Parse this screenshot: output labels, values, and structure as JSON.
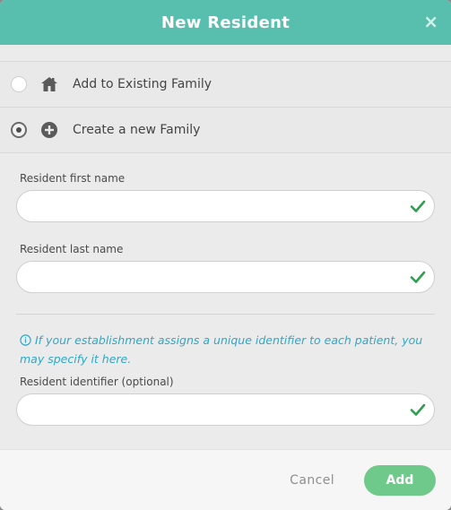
{
  "header": {
    "title": "New Resident",
    "close_symbol": "×"
  },
  "family_options": [
    {
      "label": "Add to Existing Family",
      "icon": "house-icon",
      "selected": false
    },
    {
      "label": "Create a new Family",
      "icon": "plus-circle-icon",
      "selected": true
    }
  ],
  "form": {
    "first_name": {
      "label": "Resident first name",
      "value": ""
    },
    "last_name": {
      "label": "Resident last name",
      "value": ""
    },
    "info_text": "If your establishment assigns a unique identifier to each patient, you may specify it here.",
    "identifier": {
      "label": "Resident identifier (optional)",
      "value": ""
    }
  },
  "footer": {
    "cancel_label": "Cancel",
    "add_label": "Add"
  },
  "colors": {
    "header": "#58bfae",
    "add_button": "#6fc98a",
    "check": "#2e9e4f",
    "info": "#2fa7c7"
  }
}
